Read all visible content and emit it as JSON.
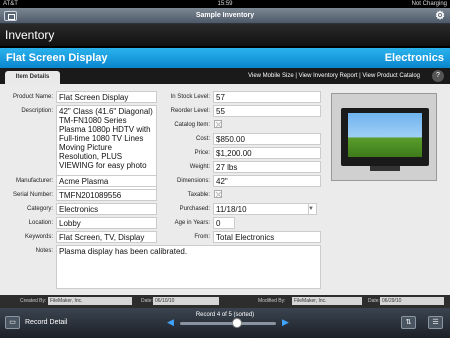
{
  "status": {
    "carrier": "AT&T",
    "time": "15:59",
    "right": "Not Charging"
  },
  "titlebar": {
    "title": "Sample Inventory",
    "left_icon": "layout-icon",
    "right_icon": "gear-icon"
  },
  "header": {
    "title": "Inventory"
  },
  "product": {
    "title": "Flat Screen Display",
    "category_header": "Electronics"
  },
  "tabs": [
    {
      "label": "Item Details"
    }
  ],
  "links": {
    "mobile": "View Mobile Size",
    "report": "View Inventory Report",
    "catalog": "View Product Catalog",
    "sep": "|"
  },
  "help": {
    "label": "?"
  },
  "left_fields": {
    "product_name": {
      "label": "Product Name:",
      "value": "Flat Screen Display"
    },
    "description": {
      "label": "Description:",
      "value": "42\" Class (41.6\" Diagonal) TM-FN1080 Series Plasma 1080p HDTV with Full-time 1080 TV Lines Moving Picture Resolution, PLUS VIEWING for easy photo"
    },
    "manufacturer": {
      "label": "Manufacturer:",
      "value": "Acme Plasma"
    },
    "serial": {
      "label": "Serial Number:",
      "value": "TMFN201089556"
    },
    "category": {
      "label": "Category:",
      "value": "Electronics"
    },
    "location": {
      "label": "Location:",
      "value": "Lobby"
    },
    "keywords": {
      "label": "Keywords:",
      "value": "Flat Screen, TV, Display"
    },
    "notes": {
      "label": "Notes:",
      "value": "Plasma display has been calibrated."
    }
  },
  "right_fields": {
    "in_stock": {
      "label": "In Stock Level:",
      "value": "57"
    },
    "reorder": {
      "label": "Reorder Level:",
      "value": "55"
    },
    "catalog_item": {
      "label": "Catalog Item:"
    },
    "cost": {
      "label": "Cost:",
      "value": "$850.00"
    },
    "price": {
      "label": "Price:",
      "value": "$1,200.00"
    },
    "weight": {
      "label": "Weight:",
      "value": "27 lbs"
    },
    "dimensions": {
      "label": "Dimensions:",
      "value": "42\""
    },
    "taxable": {
      "label": "Taxable:"
    },
    "purchased": {
      "label": "Purchased:",
      "value": "11/18/10"
    },
    "age": {
      "label": "Age in Years:",
      "value": "0"
    },
    "from": {
      "label": "From:",
      "value": "Total Electronics"
    }
  },
  "footer": {
    "created_by_label": "Created By:",
    "created_by": "FileMaker, Inc.",
    "created_date_label": "Date:",
    "created_date": "06/10/10",
    "modified_by_label": "Modified By:",
    "modified_by": "FileMaker, Inc.",
    "modified_date_label": "Date:",
    "modified_date": "06/29/10"
  },
  "bottombar": {
    "layout_label": "Record Detail",
    "record_text": "Record 4 of 5 (sorted)",
    "record_fraction": 0.6
  }
}
